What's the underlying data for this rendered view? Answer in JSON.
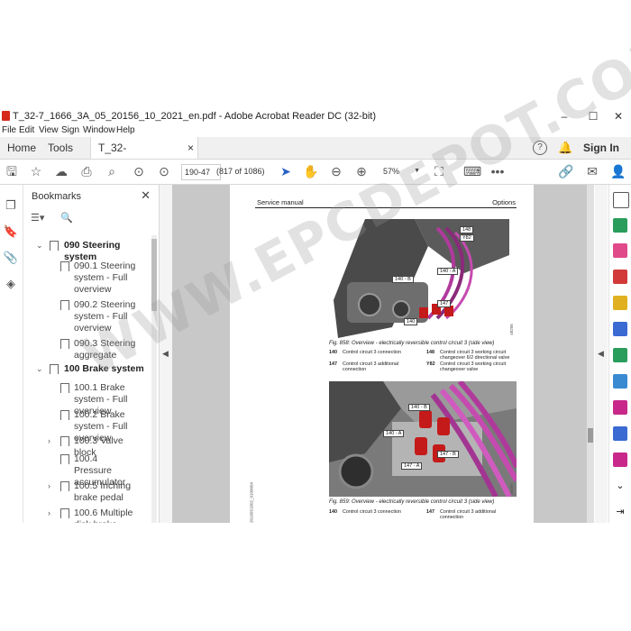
{
  "window": {
    "title": "T_32-7_1666_3A_05_20156_10_2021_en.pdf - Adobe Acrobat Reader DC (32-bit)",
    "minimize": "–",
    "maximize": "☐",
    "close": "✕"
  },
  "menu": [
    "File",
    "Edit",
    "View",
    "Sign",
    "Window",
    "Help"
  ],
  "tabs": {
    "home": "Home",
    "tools": "Tools",
    "document": "T_32-7_1666_3A_0...",
    "close": "×",
    "signin": "Sign In"
  },
  "toolbar": {
    "page_field": "190-47",
    "page_count": "(817 of 1086)",
    "zoom": "57%"
  },
  "bookmarks": {
    "title": "Bookmarks",
    "items": [
      {
        "label": "090 Steering system",
        "bold": true,
        "expanded": true
      },
      {
        "label": "090.1 Steering system - Full overview"
      },
      {
        "label": "090.2 Steering system - Full overview"
      },
      {
        "label": "090.3 Steering aggregate"
      },
      {
        "label": "100 Brake system",
        "bold": true,
        "expanded": true
      },
      {
        "label": "100.1 Brake system - Full overview"
      },
      {
        "label": "100.2 Brake system - Full overview"
      },
      {
        "label": "100.3 Valve block",
        "expandable": true
      },
      {
        "label": "100.4 Pressure accumulator"
      },
      {
        "label": "100.5 Inching brake pedal",
        "expandable": true
      },
      {
        "label": "100.6 Multiple disk brake",
        "expandable": true
      }
    ]
  },
  "document": {
    "header_left": "Service manual",
    "header_right": "Options",
    "fig1": {
      "caption": "Fig. 858: Overview - electrically reversible control circuit 3 (side view)",
      "callouts": [
        "148",
        "Y82",
        "140 - A",
        "140 - B",
        "147",
        "140"
      ],
      "side_no": "48206",
      "legend": [
        {
          "code": "140",
          "text": "Control circuit 3 connection"
        },
        {
          "code": "148",
          "text": "Control circuit 3 working circuit changeover 6/2 directional valve"
        },
        {
          "code": "147",
          "text": "Control circuit 3 additional connection"
        },
        {
          "code": "Y82",
          "text": "Control circuit 3 working circuit changeover valve"
        }
      ]
    },
    "fig2": {
      "caption": "Fig. 859: Overview - electrically reversible control circuit 3 (side view)",
      "callouts": [
        "140 - B",
        "140 - A",
        "147 - B",
        "147 - A"
      ],
      "side_no": "48207",
      "legend": [
        {
          "code": "140",
          "text": "Control circuit 3 connection"
        },
        {
          "code": "147",
          "text": "Control circuit 3 additional connection"
        }
      ]
    },
    "margin_code": "32016651602_0100004"
  },
  "watermark": "WWW.EPCDEPOT.COM"
}
